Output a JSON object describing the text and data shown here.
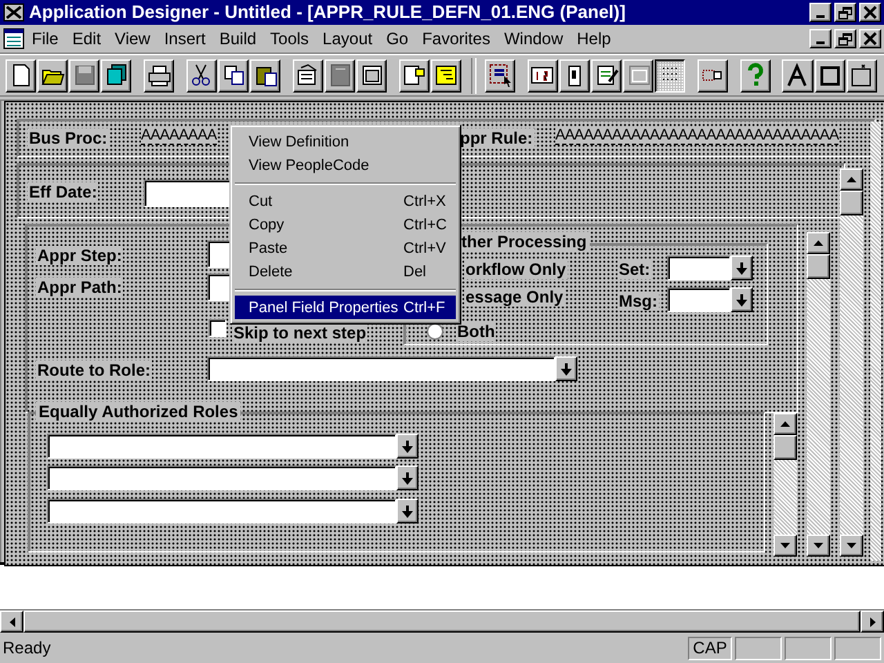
{
  "window": {
    "title": "Application Designer - Untitled - [APPR_RULE_DEFN_01.ENG (Panel)]"
  },
  "menu_bar": [
    "File",
    "Edit",
    "View",
    "Insert",
    "Build",
    "Tools",
    "Layout",
    "Go",
    "Favorites",
    "Window",
    "Help"
  ],
  "toolbar": [
    {
      "kind": "button",
      "pressed": false
    },
    {
      "kind": "button",
      "pressed": false
    },
    {
      "kind": "button",
      "pressed": false
    },
    {
      "kind": "button",
      "pressed": false
    },
    {
      "kind": "gap"
    },
    {
      "kind": "button",
      "pressed": false
    },
    {
      "kind": "gap"
    },
    {
      "kind": "button",
      "pressed": false
    },
    {
      "kind": "button",
      "pressed": false
    },
    {
      "kind": "button",
      "pressed": false
    },
    {
      "kind": "gap"
    },
    {
      "kind": "button",
      "pressed": false
    },
    {
      "kind": "button",
      "pressed": false
    },
    {
      "kind": "button",
      "pressed": false
    },
    {
      "kind": "gap"
    },
    {
      "kind": "button",
      "pressed": false
    },
    {
      "kind": "button",
      "pressed": false
    },
    {
      "kind": "separator"
    },
    {
      "kind": "button",
      "pressed": false
    },
    {
      "kind": "gap"
    },
    {
      "kind": "button",
      "pressed": false
    },
    {
      "kind": "button",
      "pressed": false
    },
    {
      "kind": "button",
      "pressed": false
    },
    {
      "kind": "button",
      "pressed": false
    },
    {
      "kind": "button",
      "pressed": true
    },
    {
      "kind": "gap"
    },
    {
      "kind": "button",
      "pressed": false
    },
    {
      "kind": "gap"
    },
    {
      "kind": "button",
      "pressed": false
    },
    {
      "kind": "gap"
    },
    {
      "kind": "button",
      "pressed": false
    },
    {
      "kind": "button",
      "pressed": false
    },
    {
      "kind": "button",
      "pressed": false
    }
  ],
  "panel": {
    "bus_proc": {
      "label": "Bus Proc:",
      "value": "AAAAAAAA"
    },
    "appr_rule": {
      "label": "ppr Rule:",
      "value": "AAAAAAAAAAAAAAAAAAAAAAAAAAAAAA"
    },
    "eff_date": {
      "label": "Eff Date:"
    },
    "appr_step": {
      "label": "Appr Step:"
    },
    "appr_path": {
      "label": "Appr Path:"
    },
    "skip": {
      "label": "Skip to next step",
      "checked": false
    },
    "other_processing": {
      "title": "ther Processing",
      "options": [
        {
          "label": "orkflow Only"
        },
        {
          "label": "essage Only"
        },
        {
          "label": "Both",
          "selected": false
        }
      ],
      "set": {
        "label": "Set:"
      },
      "msg": {
        "label": "Msg:"
      }
    },
    "route_to_role": {
      "label": "Route to Role:"
    },
    "equally_authorized_roles": {
      "title": "Equally Authorized Roles"
    }
  },
  "context_menu": [
    {
      "kind": "item",
      "label": "View Definition",
      "selected": false
    },
    {
      "kind": "item",
      "label": "View PeopleCode",
      "selected": false
    },
    {
      "kind": "separator"
    },
    {
      "kind": "item",
      "label": "Cut",
      "shortcut": "Ctrl+X",
      "selected": false
    },
    {
      "kind": "item",
      "label": "Copy",
      "shortcut": "Ctrl+C",
      "selected": false
    },
    {
      "kind": "item",
      "label": "Paste",
      "shortcut": "Ctrl+V",
      "selected": false
    },
    {
      "kind": "item",
      "label": "Delete",
      "shortcut": "Del",
      "selected": false
    },
    {
      "kind": "separator"
    },
    {
      "kind": "item",
      "label": "Panel Field Properties",
      "shortcut": "Ctrl+F",
      "selected": true
    }
  ],
  "status_bar": {
    "text": "Ready",
    "indicators": [
      "CAP"
    ]
  }
}
